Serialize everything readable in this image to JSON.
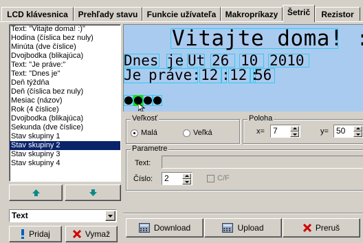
{
  "tabs": [
    "LCD klávesnica",
    "Prehľady stavu",
    "Funkcie užívateľa",
    "Makropríkazy",
    "Šetrič",
    "Rezistor"
  ],
  "active_tab": "Šetrič",
  "items": [
    "Text: \"Vitajte doma! :)\"",
    "Hodina (číslica bez nuly)",
    "Minúta (dve číslice)",
    "Dvojbodka (blikajúca)",
    "Text: \"Je práve:\"",
    "Text: \"Dnes je\"",
    "Deň týždňa",
    "Deň (číslica bez nuly)",
    "Mesiac (názov)",
    "Rok (4 číslice)",
    "Dvojbodka (blikajúca)",
    "Sekunda (dve číslice)",
    "Stav skupiny 1",
    "Stav skupiny 2",
    "Stav skupiny 3",
    "Stav skupiny 4"
  ],
  "selected_index": 13,
  "combo_value": "Text",
  "add_label": "Pridaj",
  "delete_label": "Vymaž",
  "preview": {
    "title": "Vitajte doma! :)",
    "line1": [
      "Dnes",
      "je",
      "Ut",
      "26",
      "10",
      "2010"
    ],
    "line2": [
      "Je",
      "práve:",
      "12",
      ":",
      "12",
      ":",
      "56"
    ]
  },
  "size_group": {
    "label": "Veľkosť",
    "options": [
      "Malá",
      "Veľká"
    ],
    "selected": "Malá"
  },
  "position_group": {
    "label": "Poloha",
    "x_label": "x=",
    "x_value": "7",
    "y_label": "y=",
    "y_value": "50"
  },
  "params_group": {
    "label": "Parametre",
    "text_label": "Text:",
    "text_value": "",
    "number_label": "Číslo:",
    "number_value": "2",
    "cf_label": "C/F"
  },
  "bottom_buttons": [
    "Download",
    "Upload",
    "Preruš"
  ],
  "colors": {
    "display_bg": "#aacbf0",
    "cell_border": "#38c7ee",
    "selection": "#0a246a",
    "highlight": "#18e018"
  }
}
